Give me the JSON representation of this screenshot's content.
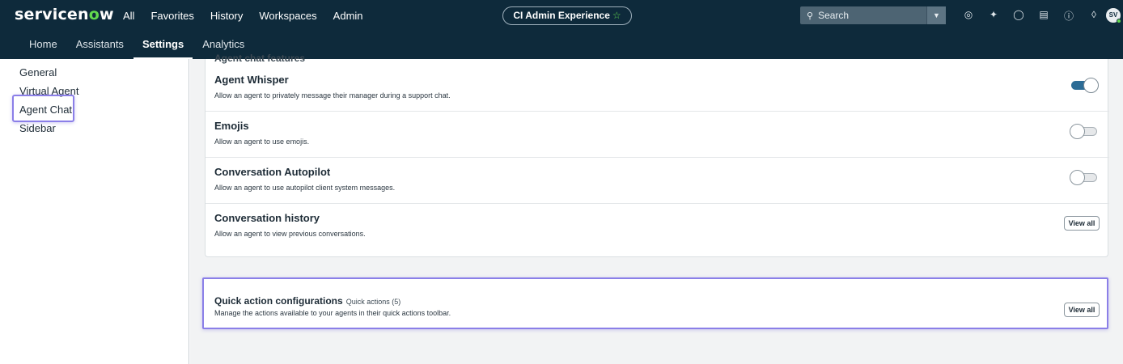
{
  "app": {
    "logo_prefix": "servicen",
    "logo_o": "o",
    "logo_suffix": "w",
    "nav": [
      "All",
      "Favorites",
      "History",
      "Workspaces",
      "Admin"
    ],
    "context_pill": "CI Admin Experience",
    "context_star": "☆",
    "search_placeholder": "Search",
    "avatar_initials": "SV"
  },
  "subnav": {
    "tabs": [
      {
        "label": "Home"
      },
      {
        "label": "Assistants"
      },
      {
        "label": "Settings",
        "active": true
      },
      {
        "label": "Analytics"
      }
    ]
  },
  "sidebar": {
    "items": [
      {
        "label": "General"
      },
      {
        "label": "Virtual Agent"
      },
      {
        "label": "Agent Chat",
        "selected": true
      },
      {
        "label": "Sidebar"
      }
    ]
  },
  "section": {
    "cut_title": "Agent chat features",
    "rows": [
      {
        "title": "Agent Whisper",
        "description": "Allow an agent to privately message their manager during a support chat.",
        "control": "toggle",
        "on": true
      },
      {
        "title": "Emojis",
        "description": "Allow an agent to use emojis.",
        "control": "toggle",
        "on": false
      },
      {
        "title": "Conversation Autopilot",
        "description": "Allow an agent to use autopilot client system messages.",
        "control": "toggle",
        "on": false
      },
      {
        "title": "Conversation history",
        "description": "Allow an agent to view previous conversations.",
        "control": "button",
        "button_label": "View all"
      }
    ]
  },
  "quick_actions": {
    "title": "Quick action configurations",
    "subtitle": "Quick actions (5)",
    "description": "Manage the actions available to your agents in their quick actions toolbar.",
    "button_label": "View all"
  },
  "colors": {
    "header_bg": "#0e2a3b",
    "brand_green": "#62d84e",
    "highlight": "#8b7fe8",
    "toggle_on": "#2c6c96"
  }
}
